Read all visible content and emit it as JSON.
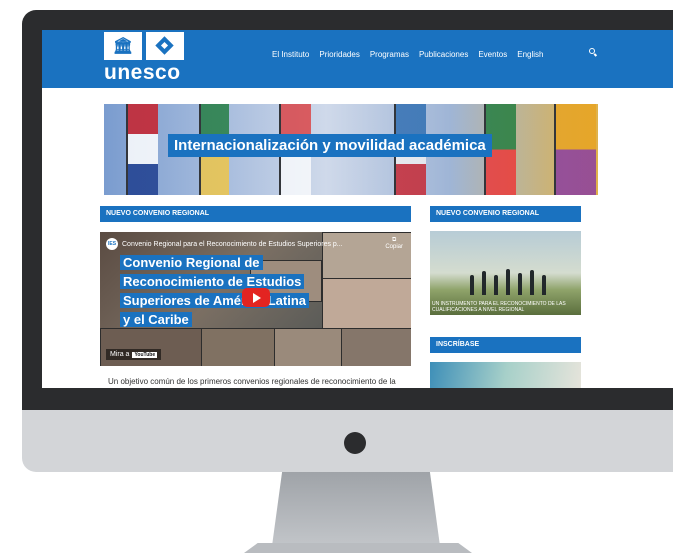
{
  "header": {
    "brand": "unesco",
    "nav": [
      "El Instituto",
      "Prioridades",
      "Programas",
      "Publicaciones",
      "Eventos",
      "English"
    ]
  },
  "banner": {
    "title": "Internacionalización y movilidad académica"
  },
  "left": {
    "section_title": "NUEVO CONVENIO REGIONAL",
    "video": {
      "channel_title": "Convenio Regional para el Reconocimiento de Estudios Superiores p...",
      "copy_label": "Copiar",
      "overlay_title": "Convenio Regional de Reconocimiento de Estudios Superiores de América Latina y el Caribe",
      "watch_label": "Mira a",
      "youtube_label": "YouTube"
    },
    "intro_text": "Un objetivo común de los primeros convenios regionales de reconocimiento de la"
  },
  "right": {
    "section1_title": "NUEVO CONVENIO REGIONAL",
    "image_caption": "UN INSTRUMENTO PARA EL RECONOCIMIENTO DE LAS CUALIFICACIONES A NIVEL REGIONAL",
    "section2_title": "INSCRÍBASE"
  },
  "colors": {
    "brand_blue": "#1a72c0",
    "bezel": "#2b2c2e",
    "chin": "#d3d5d8"
  }
}
